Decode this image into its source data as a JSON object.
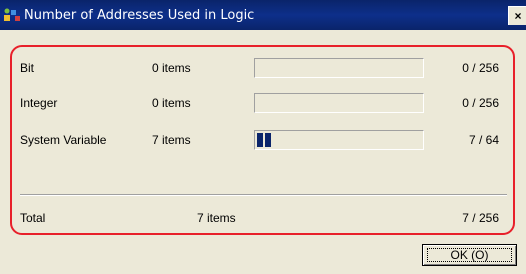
{
  "window": {
    "title": "Number of Addresses Used in Logic",
    "title_icon": "addresses-app-icon",
    "close_label": "×"
  },
  "rows": [
    {
      "label": "Bit",
      "items": "0 items",
      "count": "0 / 256",
      "progress": 0
    },
    {
      "label": "Integer",
      "items": "0 items",
      "count": "0 / 256",
      "progress": 0
    },
    {
      "label": "System Variable",
      "items": "7 items",
      "count": "7 / 64",
      "progress": 0.109
    }
  ],
  "total": {
    "label": "Total",
    "items": "7 items",
    "count": "7 / 256"
  },
  "buttons": {
    "ok_label": "OK (O)"
  },
  "colors": {
    "highlight_border": "#e8202a",
    "progress_fill": "#0a246a",
    "title_bar": "#0a246a"
  }
}
